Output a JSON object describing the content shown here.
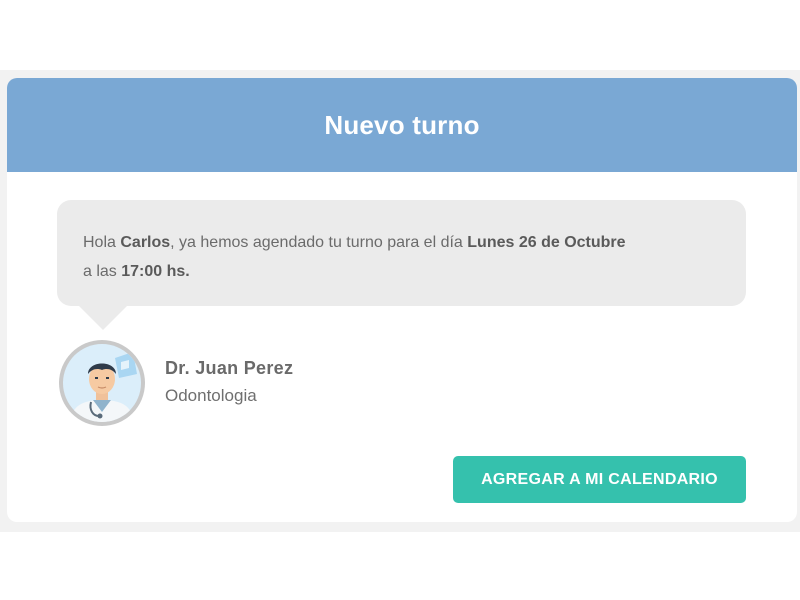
{
  "header": {
    "title": "Nuevo turno"
  },
  "message": {
    "greeting": "Hola",
    "patient_name": "Carlos",
    "text_middle": ", ya hemos agendado tu turno para el día",
    "date": "Lunes 26 de Octubre",
    "text_time_prefix": "a las",
    "time": "17:00 hs."
  },
  "doctor": {
    "name": "Dr. Juan Perez",
    "specialty": "Odontologia",
    "avatar_icon": "doctor-avatar-icon"
  },
  "actions": {
    "calendar_button_label": "AGREGAR A MI CALENDARIO"
  },
  "colors": {
    "header_bg": "#7aa8d4",
    "bubble_bg": "#ebebeb",
    "button_bg": "#35c1ad"
  }
}
